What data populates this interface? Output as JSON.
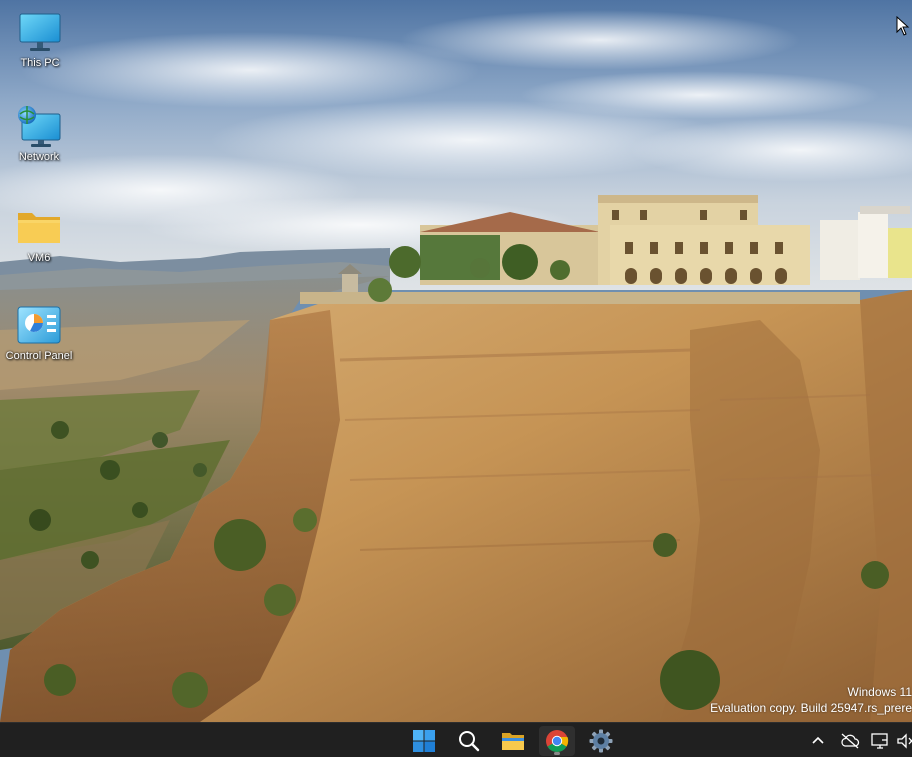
{
  "desktop": {
    "icons": [
      {
        "label": "This PC",
        "icon": "monitor-icon"
      },
      {
        "label": "Network",
        "icon": "network-icon"
      },
      {
        "label": "VM6",
        "icon": "folder-icon"
      },
      {
        "label": "Control Panel",
        "icon": "control-panel-icon"
      }
    ],
    "watermark": {
      "line1": "Windows 11",
      "line2": "Evaluation copy. Build 25947.rs_prere"
    }
  },
  "taskbar": {
    "buttons": [
      {
        "name": "start-button",
        "icon": "windows-logo-icon"
      },
      {
        "name": "search-button",
        "icon": "search-icon"
      },
      {
        "name": "file-explorer-button",
        "icon": "folder-icon"
      },
      {
        "name": "chrome-button",
        "icon": "chrome-icon",
        "active": true
      },
      {
        "name": "settings-button",
        "icon": "gear-icon"
      }
    ],
    "tray": [
      {
        "name": "show-hidden-icons-button",
        "icon": "chevron-up-icon"
      },
      {
        "name": "onedrive-button",
        "icon": "cloud-off-icon"
      },
      {
        "name": "network-status-button",
        "icon": "network-monitor-icon"
      },
      {
        "name": "volume-button",
        "icon": "speaker-muted-icon"
      }
    ]
  },
  "colors": {
    "taskbar": "#202020",
    "accent": "#0078d4",
    "folder": "#f5c542"
  }
}
